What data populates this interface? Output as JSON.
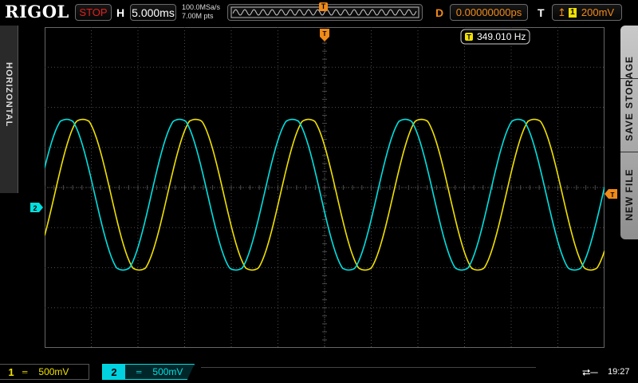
{
  "header": {
    "brand": "RIGOL",
    "run_state": "STOP",
    "horizontal_label": "H",
    "timebase": "5.000ms",
    "sample_rate": "100.0MSa/s",
    "memory_depth": "7.00M pts",
    "delay_label": "D",
    "delay_value": "0.00000000ps",
    "trigger_label": "T",
    "trigger_source": "1",
    "trigger_level": "200mV",
    "trigger_marker": "T"
  },
  "side_menu_left": {
    "label": "HORIZONTAL"
  },
  "side_menu_right": {
    "items": [
      "STORAGE",
      "SAVE",
      "NEW FILE"
    ]
  },
  "screen": {
    "frequency_readout": "349.010 Hz",
    "frequency_tag": "T",
    "ch2_ref_marker": "2",
    "trigger_level_marker": "T",
    "trigger_pos_marker": "T"
  },
  "channels": [
    {
      "number": "1",
      "coupling_icon": "dc-coupling-icon",
      "scale": "500mV",
      "color": "#f0e000"
    },
    {
      "number": "2",
      "coupling_icon": "dc-coupling-icon",
      "scale": "500mV",
      "color": "#00e0e0"
    }
  ],
  "status": {
    "usb_icon": "usb-icon",
    "time": "19:27"
  },
  "colors": {
    "ch1": "#f0e000",
    "ch2": "#00e0e0",
    "trigger": "#f08a18",
    "stop": "#e0201c",
    "grid": "#4a4a4a"
  },
  "waveforms": [
    {
      "channel": "1",
      "shape": "sine",
      "cycles_visible": 5
    },
    {
      "channel": "2",
      "shape": "sine",
      "cycles_visible": 5,
      "phase": "leads channel 1"
    }
  ]
}
